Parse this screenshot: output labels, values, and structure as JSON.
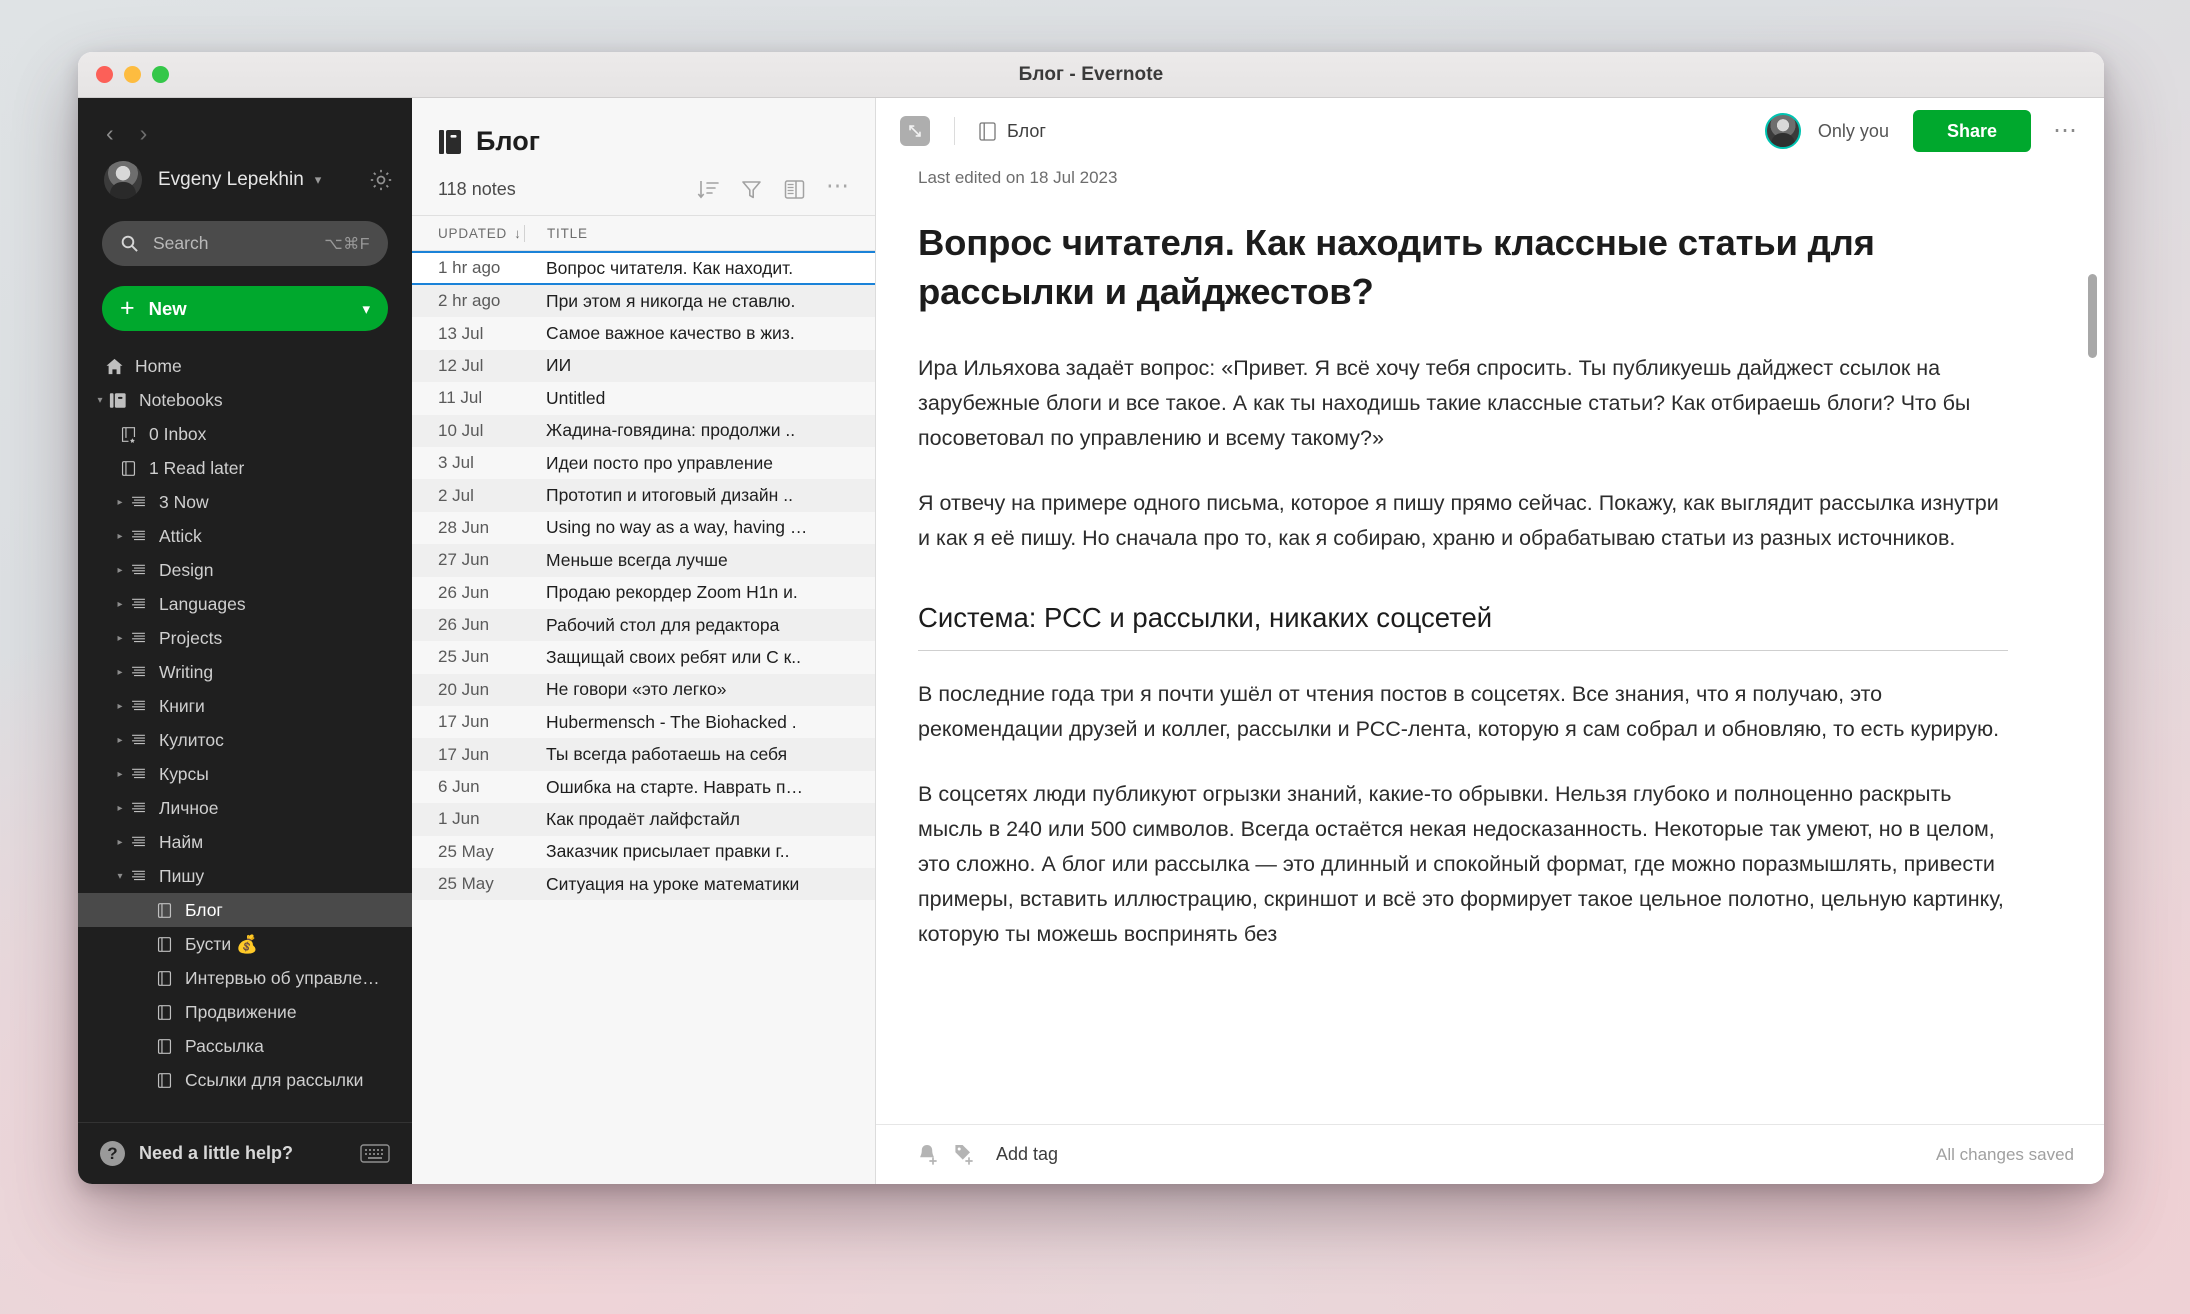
{
  "window": {
    "title": "Блог - Evernote"
  },
  "sidebar": {
    "account": {
      "name": "Evgeny Lepekhin"
    },
    "search": {
      "placeholder": "Search",
      "shortcut": "⌥⌘F"
    },
    "new_button": {
      "label": "New"
    },
    "nav": [
      {
        "label": "Home",
        "icon": "home-icon",
        "level": 0,
        "twisty": ""
      },
      {
        "label": "Notebooks",
        "icon": "notebooks-icon",
        "level": 1,
        "twisty": "down"
      },
      {
        "label": "0 Inbox",
        "icon": "notebook-star-icon",
        "level": 2,
        "twisty": ""
      },
      {
        "label": "1 Read later",
        "icon": "notebook-icon",
        "level": 2,
        "twisty": ""
      },
      {
        "label": "3 Now",
        "icon": "stack-icon",
        "level": 2.5,
        "twisty": "right"
      },
      {
        "label": "Attick",
        "icon": "stack-icon",
        "level": 2.5,
        "twisty": "right"
      },
      {
        "label": "Design",
        "icon": "stack-icon",
        "level": 2.5,
        "twisty": "right"
      },
      {
        "label": "Languages",
        "icon": "stack-icon",
        "level": 2.5,
        "twisty": "right"
      },
      {
        "label": "Projects",
        "icon": "stack-icon",
        "level": 2.5,
        "twisty": "right"
      },
      {
        "label": "Writing",
        "icon": "stack-icon",
        "level": 2.5,
        "twisty": "right"
      },
      {
        "label": "Книги",
        "icon": "stack-icon",
        "level": 2.5,
        "twisty": "right"
      },
      {
        "label": "Кулитос",
        "icon": "stack-icon",
        "level": 2.5,
        "twisty": "right"
      },
      {
        "label": "Курсы",
        "icon": "stack-icon",
        "level": 2.5,
        "twisty": "right"
      },
      {
        "label": "Личное",
        "icon": "stack-icon",
        "level": 2.5,
        "twisty": "right"
      },
      {
        "label": "Найм",
        "icon": "stack-icon",
        "level": 2.5,
        "twisty": "right"
      },
      {
        "label": "Пишу",
        "icon": "stack-icon",
        "level": 2.5,
        "twisty": "down"
      },
      {
        "label": "Блог",
        "icon": "notebook-icon",
        "level": 3,
        "twisty": "",
        "selected": true
      },
      {
        "label": "Бусти 💰",
        "icon": "notebook-icon",
        "level": 3,
        "twisty": ""
      },
      {
        "label": "Интервью об управле…",
        "icon": "notebook-icon",
        "level": 3,
        "twisty": ""
      },
      {
        "label": "Продвижение",
        "icon": "notebook-icon",
        "level": 3,
        "twisty": ""
      },
      {
        "label": "Рассылка",
        "icon": "notebook-icon",
        "level": 3,
        "twisty": ""
      },
      {
        "label": "Ссылки для рассылки",
        "icon": "notebook-icon",
        "level": 3,
        "twisty": ""
      }
    ],
    "help": {
      "label": "Need a little help?"
    }
  },
  "notelist": {
    "title": "Блог",
    "count_label": "118 notes",
    "columns": {
      "updated": "UPDATED",
      "title": "TITLE",
      "sort_dir": "↓"
    },
    "tools": [
      "sort-icon",
      "filter-icon",
      "view-icon",
      "more-icon"
    ],
    "rows": [
      {
        "date": "1 hr ago",
        "title": "Вопрос читателя. Как находит.",
        "selected": true
      },
      {
        "date": "2 hr ago",
        "title": "При этом я никогда не ставлю."
      },
      {
        "date": "13 Jul",
        "title": "Самое важное качество в жиз."
      },
      {
        "date": "12 Jul",
        "title": "ИИ"
      },
      {
        "date": "11 Jul",
        "title": "Untitled"
      },
      {
        "date": "10 Jul",
        "title": "Жадина-говядина: продолжи .."
      },
      {
        "date": "3 Jul",
        "title": "Идеи посто про управление"
      },
      {
        "date": "2 Jul",
        "title": "Прототип и итоговый дизайн .."
      },
      {
        "date": "28 Jun",
        "title": "Using no way as a way, having …"
      },
      {
        "date": "27 Jun",
        "title": "Меньше всегда лучше"
      },
      {
        "date": "26 Jun",
        "title": "Продаю рекордер Zoom H1n и."
      },
      {
        "date": "26 Jun",
        "title": "Рабочий стол для редактора"
      },
      {
        "date": "25 Jun",
        "title": "Защищай своих ребят или С к.."
      },
      {
        "date": "20 Jun",
        "title": "Не говори «это легко»"
      },
      {
        "date": "17 Jun",
        "title": "Hubermensch - The Biohacked ."
      },
      {
        "date": "17 Jun",
        "title": "Ты всегда работаешь на себя"
      },
      {
        "date": "6 Jun",
        "title": "Ошибка на старте. Наврать п…"
      },
      {
        "date": "1 Jun",
        "title": "Как продаёт лайфстайл"
      },
      {
        "date": "25 May",
        "title": "Заказчик присылает правки г.."
      },
      {
        "date": "25 May",
        "title": "Ситуация на уроке математики"
      }
    ]
  },
  "editor": {
    "breadcrumb": "Блог",
    "last_edited": "Last edited on 18 Jul 2023",
    "share": {
      "only_you": "Only you",
      "share_label": "Share"
    },
    "note": {
      "title": "Вопрос читателя. Как находить классные статьи для рассылки и дайджестов?",
      "p1": "Ира Ильяхова задаёт вопрос: «Привет. Я всё хочу тебя спросить. Ты публикуешь дайджест ссылок на зарубежные блоги и все такое. А как ты находишь такие классные статьи? Как отбираешь блоги? Что бы посоветовал по управлению и всему такому?»",
      "p2": "Я отвечу на примере одного письма, которое я пишу прямо сейчас. Покажу, как выглядит рассылка изнутри и как я её пишу. Но сначала про то, как я собираю, храню и обрабатываю статьи из разных источников.",
      "h2": "Система: РСС и рассылки, никаких соцсетей",
      "p3": "В последние года три я почти ушёл от чтения постов в соцсетях. Все знания, что я получаю, это рекомендации друзей и коллег, рассылки и РСС-лента, которую я сам собрал и обновляю, то есть курирую.",
      "p4": "В соцсетях люди публикуют огрызки знаний, какие-то обрывки. Нельзя глубоко и полноценно раскрыть мысль в 240 или 500 символов. Всегда остаётся некая недосказанность. Некоторые так умеют, но в целом, это сложно. А блог или рассылка — это длинный и спокойный формат, где можно поразмышлять, привести примеры, вставить иллюстрацию, скриншот и всё это формирует такое цельное полотно, цельную картинку, которую ты можешь воспринять без"
    },
    "footer": {
      "add_tag": "Add tag",
      "status": "All changes saved"
    }
  },
  "colors": {
    "brand_green": "#00a82d",
    "selection_blue": "#1a82d8",
    "sidebar_bg": "#1f1f1f"
  }
}
